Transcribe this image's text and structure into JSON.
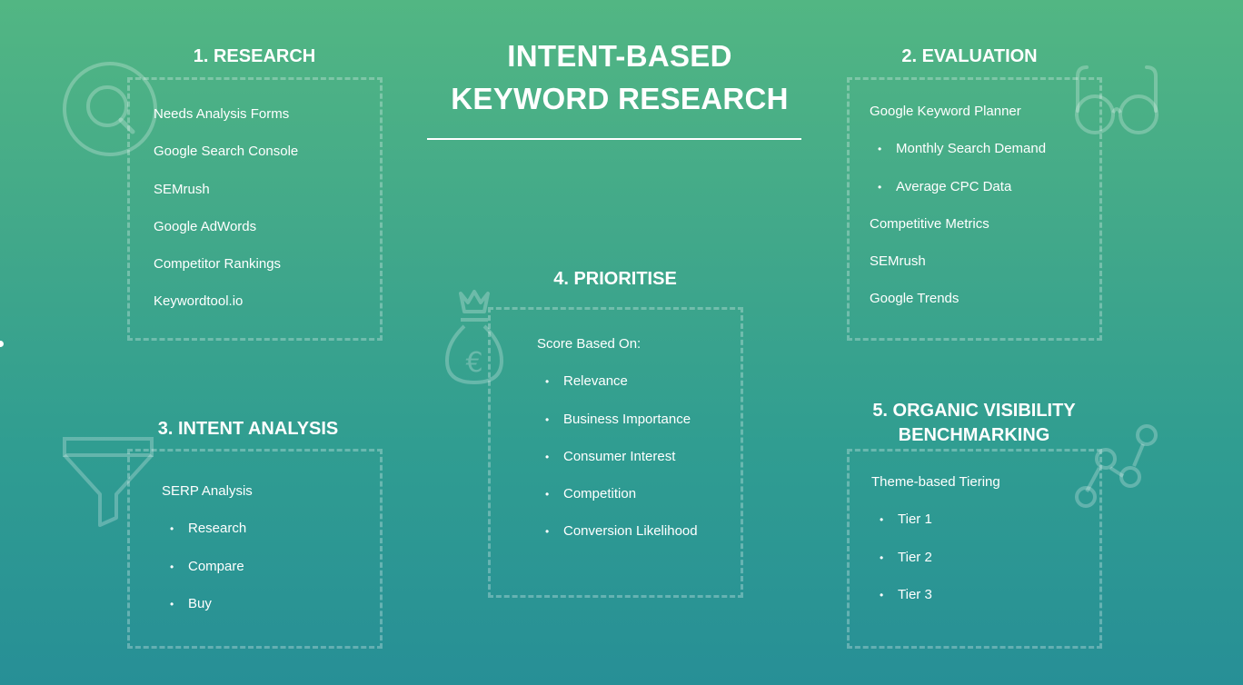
{
  "header": {
    "title_line1": "INTENT-BASED",
    "title_line2": "KEYWORD RESEARCH"
  },
  "colors": {
    "background_top": "#52b683",
    "background_bottom": "#278f96",
    "text": "#ffffff"
  },
  "sections": {
    "research": {
      "title": "1. RESEARCH",
      "icon": "magnifier-circle-icon",
      "items": [
        {
          "text": "Needs Analysis Forms",
          "bullet": false
        },
        {
          "text": "Google Search Console",
          "bullet": false
        },
        {
          "text": "SEMrush",
          "bullet": false
        },
        {
          "text": "Google AdWords",
          "bullet": false
        },
        {
          "text": "Competitor Rankings",
          "bullet": false
        },
        {
          "text": "Keywordtool.io",
          "bullet": false
        }
      ]
    },
    "evaluation": {
      "title": "2. EVALUATION",
      "icon": "glasses-icon",
      "items": [
        {
          "text": "Google Keyword Planner",
          "bullet": false
        },
        {
          "text": "Monthly Search Demand",
          "bullet": true
        },
        {
          "text": "Average CPC Data",
          "bullet": true
        },
        {
          "text": "Competitive Metrics",
          "bullet": false
        },
        {
          "text": "SEMrush",
          "bullet": false
        },
        {
          "text": "Google Trends",
          "bullet": false
        }
      ]
    },
    "intent_analysis": {
      "title": "3. INTENT ANALYSIS",
      "icon": "funnel-icon",
      "items": [
        {
          "text": "SERP Analysis",
          "bullet": false
        },
        {
          "text": "Research",
          "bullet": true
        },
        {
          "text": "Compare",
          "bullet": true
        },
        {
          "text": "Buy",
          "bullet": true
        }
      ]
    },
    "prioritise": {
      "title": "4. PRIORITISE",
      "icon": "euro-money-bag-icon",
      "items": [
        {
          "text": "Score Based On:",
          "bullet": false
        },
        {
          "text": "Relevance",
          "bullet": true
        },
        {
          "text": "Business Importance",
          "bullet": true
        },
        {
          "text": "Consumer Interest",
          "bullet": true
        },
        {
          "text": "Competition",
          "bullet": true
        },
        {
          "text": "Conversion Likelihood",
          "bullet": true
        }
      ]
    },
    "benchmarking": {
      "title_line1": "5. ORGANIC VISIBILITY",
      "title_line2": "BENCHMARKING",
      "icon": "line-graph-icon",
      "items": [
        {
          "text": "Theme-based Tiering",
          "bullet": false
        },
        {
          "text": "Tier 1",
          "bullet": true
        },
        {
          "text": "Tier 2",
          "bullet": true
        },
        {
          "text": "Tier 3",
          "bullet": true
        }
      ]
    }
  },
  "bullet_glyph": "•"
}
